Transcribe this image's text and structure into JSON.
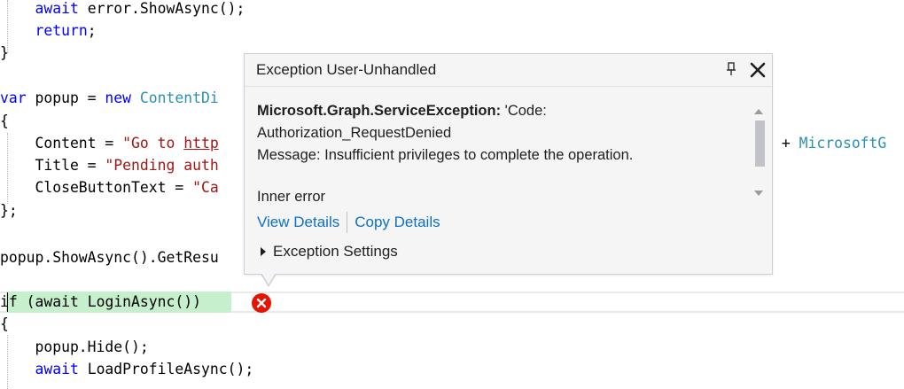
{
  "code": {
    "l1": "    await error.ShowAsync();",
    "l1_kw": "await",
    "l1_rest": " error.ShowAsync();",
    "l2_kw": "return",
    "l2_rest": ";",
    "l3": "}",
    "l5_kw1": "var",
    "l5_mid": " popup = ",
    "l5_kw2": "new",
    "l5_type": "ContentDi",
    "l6": "{",
    "l7_a": "    Content = ",
    "l7_str": "\"Go to ",
    "l7_link": "http",
    "l7_tail": " + ",
    "l7_tail_type": "MicrosoftG",
    "l8_a": "    Title = ",
    "l8_str": "\"Pending auth",
    "l9_a": "    CloseButtonText = ",
    "l9_str": "\"Ca",
    "l10": "};",
    "l12": "popup.ShowAsync().GetResu",
    "l14_kw1": "if",
    "l14_mid1": " (",
    "l14_kw2": "await",
    "l14_rest": " LoginAsync())",
    "l15": "{",
    "l16": "    popup.Hide();",
    "l17_kw": "await",
    "l17_rest": " LoadProfileAsync();"
  },
  "popup": {
    "title": "Exception User-Unhandled",
    "exception_type": "Microsoft.Graph.ServiceException:",
    "message_line1_tail": " 'Code:",
    "message_line2": "Authorization_RequestDenied",
    "message_line3": "Message: Insufficient privileges to complete the operation.",
    "inner_error": "Inner error",
    "view_details": "View Details",
    "copy_details": "Copy Details",
    "exception_settings": "Exception Settings"
  },
  "colors": {
    "keyword": "#0000ff",
    "type": "#2b91af",
    "string": "#a31515",
    "link": "#0e70c0",
    "statement_highlight": "#c6efce",
    "error_red": "#e51400"
  },
  "icons": [
    "pin-icon",
    "close-icon",
    "scroll-up-icon",
    "scroll-down-icon",
    "error-icon",
    "expand-triangle-icon"
  ]
}
